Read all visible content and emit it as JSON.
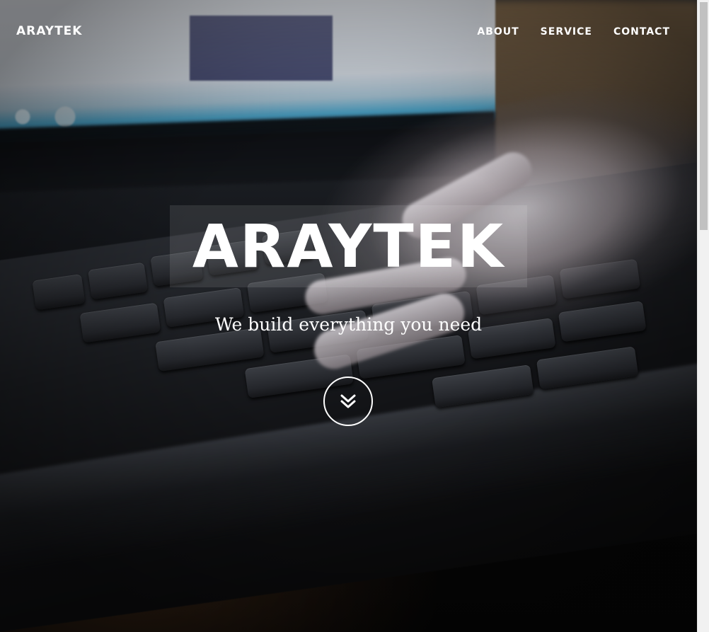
{
  "nav": {
    "brand": "ARAYTEK",
    "links": [
      "ABOUT",
      "SERVICE",
      "CONTACT"
    ]
  },
  "hero": {
    "title": "ARAYTEK",
    "subtitle": "We build everything you need",
    "scroll_icon": "chevron-double-down-icon",
    "background_image": "hand typing on laptop keyboard"
  },
  "colors": {
    "text": "#ffffff",
    "title_box": "rgba(255,255,255,0.10)",
    "scrollbar_track": "#f1f1f1",
    "scrollbar_thumb": "#c1c1c1"
  }
}
